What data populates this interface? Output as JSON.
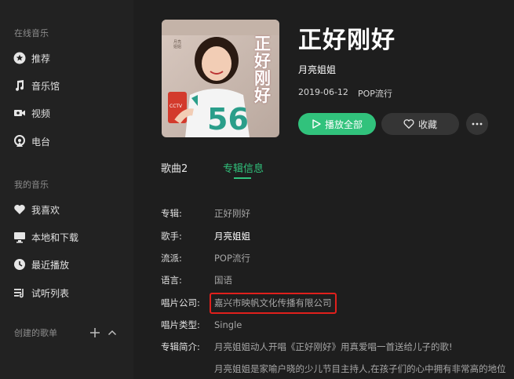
{
  "sidebar": {
    "online_title": "在线音乐",
    "online_items": [
      {
        "label": "推荐",
        "icon": "star-icon"
      },
      {
        "label": "音乐馆",
        "icon": "music-note-icon"
      },
      {
        "label": "视频",
        "icon": "video-icon"
      },
      {
        "label": "电台",
        "icon": "radio-icon"
      }
    ],
    "my_title": "我的音乐",
    "my_items": [
      {
        "label": "我喜欢",
        "icon": "heart-icon"
      },
      {
        "label": "本地和下载",
        "icon": "monitor-icon"
      },
      {
        "label": "最近播放",
        "icon": "clock-icon"
      },
      {
        "label": "试听列表",
        "icon": "playlist-icon"
      }
    ],
    "created_title": "创建的歌单"
  },
  "album": {
    "title": "正好刚好",
    "artist": "月亮姐姐",
    "date": "2019-06-12",
    "genre": "POP流行",
    "cover_text": "正好刚好",
    "cover_small_text": "月亮姐姐"
  },
  "actions": {
    "play_all": "播放全部",
    "favorite": "收藏"
  },
  "tabs": {
    "songs": "歌曲2",
    "info": "专辑信息"
  },
  "info": {
    "album_label": "专辑:",
    "album_value": "正好刚好",
    "singer_label": "歌手:",
    "singer_value": "月亮姐姐",
    "genre_label": "流派:",
    "genre_value": "POP流行",
    "language_label": "语言:",
    "language_value": "国语",
    "company_label": "唱片公司:",
    "company_value": "嘉兴市映帆文化传播有限公司",
    "type_label": "唱片类型:",
    "type_value": "Single",
    "intro_label": "专辑简介:",
    "intro_line1": "月亮姐姐动人开唱《正好刚好》用真爱唱一首送给儿子的歌!",
    "intro_line2": "月亮姐姐是家喻户晓的少儿节目主持人,在孩子们的心中拥有非常高的地位"
  },
  "colors": {
    "accent": "#31c27c",
    "highlight": "#e0201c",
    "sidebar_bg": "#222222",
    "main_bg": "#1e1e1e"
  }
}
